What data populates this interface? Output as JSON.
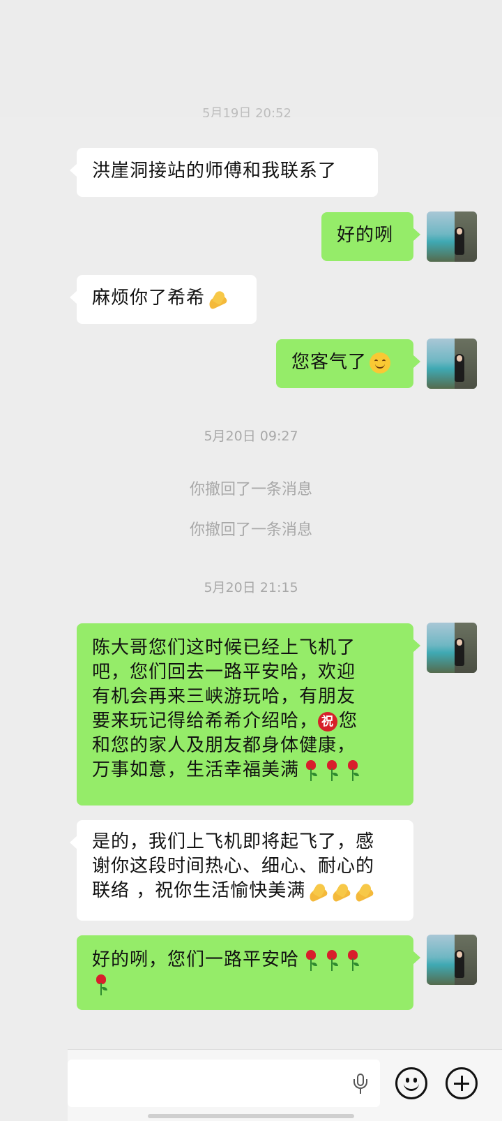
{
  "header_faded_time": "5月19日 20:52",
  "messages": [
    {
      "side": "left",
      "text": "洪崖洞接站的师傅和我联系了"
    },
    {
      "side": "right",
      "text": "好的咧"
    },
    {
      "side": "left",
      "text": "麻烦你了希希",
      "emoji": "folded-hands"
    },
    {
      "side": "right",
      "text": "您客气了",
      "emoji": "smile"
    }
  ],
  "time_1": "5月20日 09:27",
  "recall_1": "你撤回了一条消息",
  "recall_2": "你撤回了一条消息",
  "time_2": "5月20日 21:15",
  "msg5": {
    "line1": "陈大哥您们这时候已经上飞机了",
    "line2": "吧，您们回去一路平安哈，欢迎",
    "line3": "有机会再来三峡游玩哈，有朋友",
    "line4": "要来玩记得给希希介绍哈，",
    "zhu_badge": "祝",
    "line4_tail": "您",
    "line5": "和您的家人及朋友都身体健康，",
    "line6": "万事如意，生活幸福美满"
  },
  "msg6": {
    "line1": "是的，我们上飞机即将起飞了，感",
    "line2": "谢你这段时间热心、细心、耐心的",
    "line3": "联络 ，祝你生活愉快美满"
  },
  "msg7": {
    "line1": "好的咧，您们一路平安哈"
  },
  "input_bar": {
    "placeholder": ""
  }
}
